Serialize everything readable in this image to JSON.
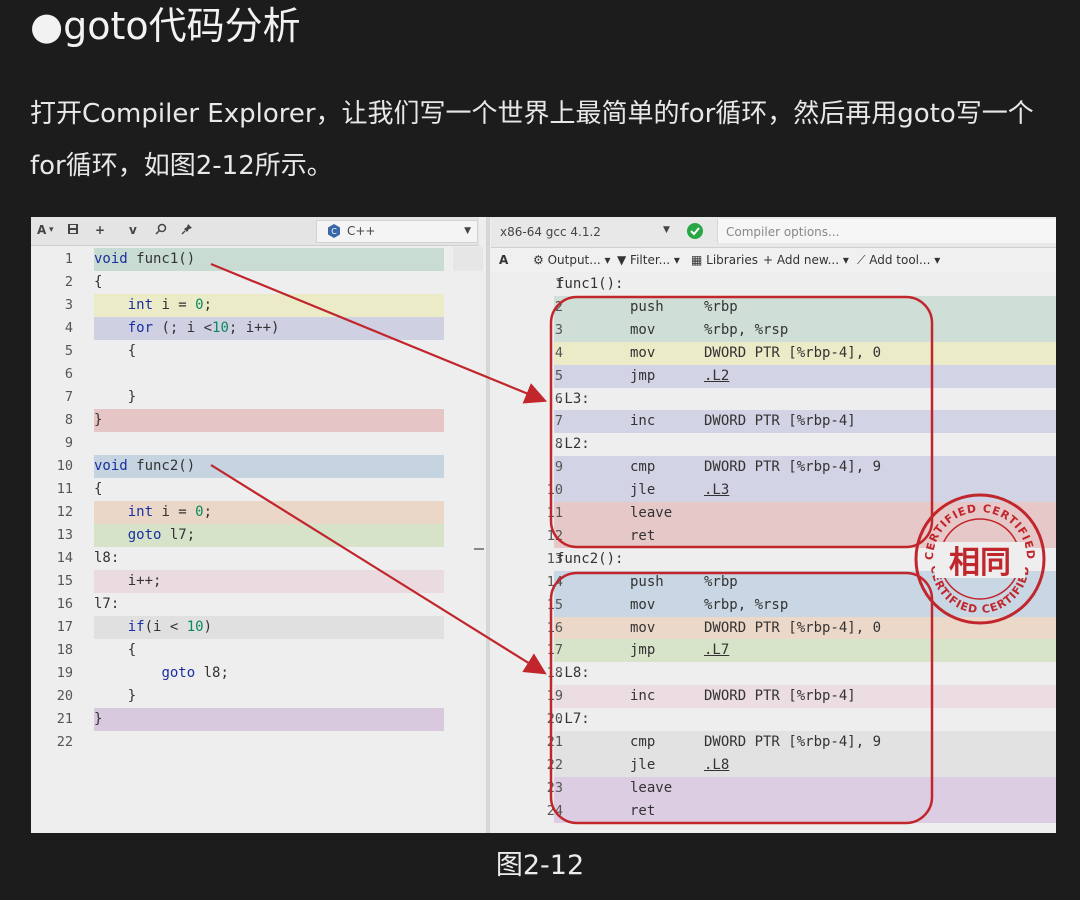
{
  "heading": "●goto代码分析",
  "paragraph": "打开Compiler Explorer，让我们写一个世界上最简单的for循环，然后再用goto写一个for循环，如图2-12所示。",
  "caption": "图2-12",
  "editor": {
    "toolbar": [
      "A",
      "▾",
      "💾",
      "+",
      "v",
      "⚲",
      "✎"
    ],
    "language": "C++",
    "lines": [
      {
        "n": "1",
        "code": "void func1()",
        "bg": "#c9dcd4"
      },
      {
        "n": "2",
        "code": "{",
        "bg": ""
      },
      {
        "n": "3",
        "code": "    int i = 0;",
        "bg": "#ecebc8"
      },
      {
        "n": "4",
        "code": "    for (; i <10; i++)",
        "bg": "#cfd0e2"
      },
      {
        "n": "5",
        "code": "    {",
        "bg": ""
      },
      {
        "n": "6",
        "code": "",
        "bg": ""
      },
      {
        "n": "7",
        "code": "    }",
        "bg": ""
      },
      {
        "n": "8",
        "code": "}",
        "bg": "#e5c5c5"
      },
      {
        "n": "9",
        "code": "",
        "bg": ""
      },
      {
        "n": "10",
        "code": "void func2()",
        "bg": "#c6d3e0"
      },
      {
        "n": "11",
        "code": "{",
        "bg": ""
      },
      {
        "n": "12",
        "code": "    int i = 0;",
        "bg": "#ead7c7"
      },
      {
        "n": "13",
        "code": "    goto l7;",
        "bg": "#d6e3c8"
      },
      {
        "n": "14",
        "code": "l8:",
        "bg": ""
      },
      {
        "n": "15",
        "code": "    i++;",
        "bg": "#eadbe0"
      },
      {
        "n": "16",
        "code": "l7:",
        "bg": ""
      },
      {
        "n": "17",
        "code": "    if(i < 10)",
        "bg": "#e0e0e0"
      },
      {
        "n": "18",
        "code": "    {",
        "bg": ""
      },
      {
        "n": "19",
        "code": "        goto l8;",
        "bg": ""
      },
      {
        "n": "20",
        "code": "    }",
        "bg": ""
      },
      {
        "n": "21",
        "code": "}",
        "bg": "#d9c9df"
      },
      {
        "n": "22",
        "code": "",
        "bg": ""
      }
    ]
  },
  "compiler": {
    "name": "x86-64 gcc 4.1.2",
    "options_placeholder": "Compiler options...",
    "tools": [
      "A",
      "Output...",
      "Filter...",
      "Libraries",
      "+ Add new...",
      "Add tool..."
    ],
    "lines": [
      {
        "n": "1",
        "label": "func1():",
        "ins": "",
        "arg": "",
        "link": "",
        "bg": ""
      },
      {
        "n": "2",
        "label": "",
        "ins": "push",
        "arg": "%rbp",
        "link": "",
        "bg": "#cfdfd8"
      },
      {
        "n": "3",
        "label": "",
        "ins": "mov",
        "arg": "%rbp, %rsp",
        "link": "",
        "bg": "#cfdfd8"
      },
      {
        "n": "4",
        "label": "",
        "ins": "mov",
        "arg": "DWORD PTR [%rbp-4], 0",
        "link": "",
        "bg": "#ecebc8"
      },
      {
        "n": "5",
        "label": "",
        "ins": "jmp",
        "arg": "",
        "link": ".L2",
        "bg": "#d2d3e4"
      },
      {
        "n": "6",
        "label": ".L3:",
        "ins": "",
        "arg": "",
        "link": "",
        "bg": ""
      },
      {
        "n": "7",
        "label": "",
        "ins": "inc",
        "arg": "DWORD PTR [%rbp-4]",
        "link": "",
        "bg": "#d2d3e4"
      },
      {
        "n": "8",
        "label": ".L2:",
        "ins": "",
        "arg": "",
        "link": "",
        "bg": ""
      },
      {
        "n": "9",
        "label": "",
        "ins": "cmp",
        "arg": "DWORD PTR [%rbp-4], 9",
        "link": "",
        "bg": "#d2d3e4"
      },
      {
        "n": "10",
        "label": "",
        "ins": "jle",
        "arg": "",
        "link": ".L3",
        "bg": "#d2d3e4"
      },
      {
        "n": "11",
        "label": "",
        "ins": "leave",
        "arg": "",
        "link": "",
        "bg": "#e7c8c8"
      },
      {
        "n": "12",
        "label": "",
        "ins": "ret",
        "arg": "",
        "link": "",
        "bg": "#e7c8c8"
      },
      {
        "n": "13",
        "label": "func2():",
        "ins": "",
        "arg": "",
        "link": "",
        "bg": ""
      },
      {
        "n": "14",
        "label": "",
        "ins": "push",
        "arg": "%rbp",
        "link": "",
        "bg": "#c9d6e3"
      },
      {
        "n": "15",
        "label": "",
        "ins": "mov",
        "arg": "%rbp, %rsp",
        "link": "",
        "bg": "#c9d6e3"
      },
      {
        "n": "16",
        "label": "",
        "ins": "mov",
        "arg": "DWORD PTR [%rbp-4], 0",
        "link": "",
        "bg": "#ecd8c8"
      },
      {
        "n": "17",
        "label": "",
        "ins": "jmp",
        "arg": "",
        "link": ".L7",
        "bg": "#d8e4c9"
      },
      {
        "n": "18",
        "label": ".L8:",
        "ins": "",
        "arg": "",
        "link": "",
        "bg": ""
      },
      {
        "n": "19",
        "label": "",
        "ins": "inc",
        "arg": "DWORD PTR [%rbp-4]",
        "link": "",
        "bg": "#ecdde2"
      },
      {
        "n": "20",
        "label": ".L7:",
        "ins": "",
        "arg": "",
        "link": "",
        "bg": ""
      },
      {
        "n": "21",
        "label": "",
        "ins": "cmp",
        "arg": "DWORD PTR [%rbp-4], 9",
        "link": "",
        "bg": "#e2e2e2"
      },
      {
        "n": "22",
        "label": "",
        "ins": "jle",
        "arg": "",
        "link": ".L8",
        "bg": "#e2e2e2"
      },
      {
        "n": "23",
        "label": "",
        "ins": "leave",
        "arg": "",
        "link": "",
        "bg": "#dccde2"
      },
      {
        "n": "24",
        "label": "",
        "ins": "ret",
        "arg": "",
        "link": "",
        "bg": "#dccde2"
      }
    ]
  },
  "stamp": {
    "text": "相同",
    "ring_text": "CERTIFIED CERTIFIED",
    "color": "#c0262c"
  },
  "colors": {
    "arrow": "#c0262c",
    "box": "#c0262c"
  }
}
